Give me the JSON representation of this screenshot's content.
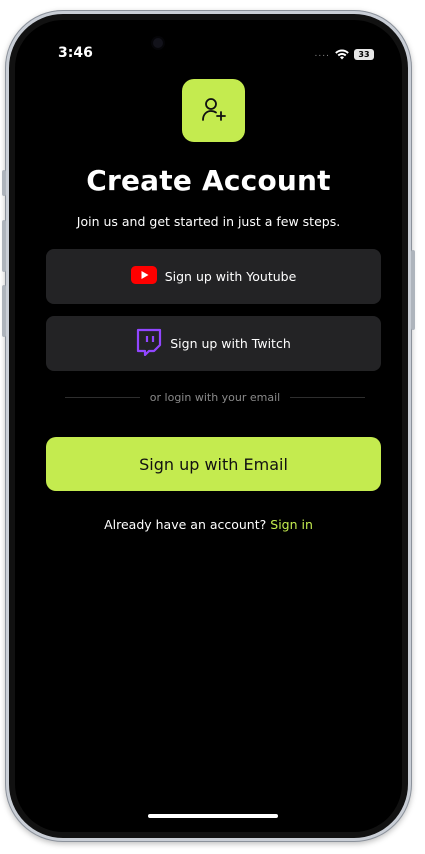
{
  "status_bar": {
    "time": "3:46",
    "signal": "....",
    "battery": "33"
  },
  "header": {
    "icon": "add-user-icon",
    "title": "Create Account",
    "subtitle": "Join us and get started in just a few steps."
  },
  "social_buttons": [
    {
      "label": "Sign up with Youtube",
      "icon": "youtube-icon"
    },
    {
      "label": "Sign up with Twitch",
      "icon": "twitch-icon"
    }
  ],
  "divider": {
    "text": "or login with your email"
  },
  "email_button": {
    "label": "Sign up with Email"
  },
  "footer": {
    "prompt": "Already have an account?",
    "link": "Sign in"
  },
  "colors": {
    "accent": "#c4eb4f",
    "background": "#000000",
    "button_surface": "#232325",
    "youtube_red": "#ff0000",
    "twitch_purple": "#9146ff"
  }
}
